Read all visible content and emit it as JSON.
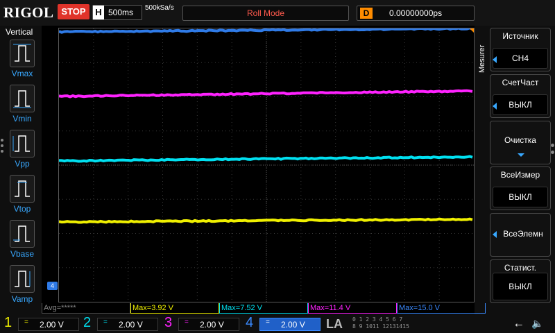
{
  "topbar": {
    "logo": "RIGOL",
    "run_state": "STOP",
    "timebase_icon": "H",
    "timebase": "500ms",
    "sample_rate": "500kSa/s",
    "mode": "Roll Mode",
    "delay_icon": "D",
    "delay": "0.00000000ps"
  },
  "left_menu": {
    "title": "Vertical",
    "items": [
      {
        "label": "Vmax",
        "icon": "vmax-icon"
      },
      {
        "label": "Vmin",
        "icon": "vmin-icon"
      },
      {
        "label": "Vpp",
        "icon": "vpp-icon"
      },
      {
        "label": "Vtop",
        "icon": "vtop-icon"
      },
      {
        "label": "Vbase",
        "icon": "vbase-icon"
      },
      {
        "label": "Vamp",
        "icon": "vamp-icon"
      }
    ]
  },
  "right_menu": {
    "side_label": "Mesurer",
    "buttons": [
      {
        "title": "Источник",
        "value": "CH4"
      },
      {
        "title": "СчетЧаст",
        "value": "ВЫКЛ"
      },
      {
        "title": "Очистка",
        "value": ""
      },
      {
        "title": "ВсеИзмер",
        "value": "ВЫКЛ"
      },
      {
        "title": "",
        "value": "ВсеЭлемн"
      },
      {
        "title": "Статист.",
        "value": "ВЫКЛ"
      }
    ]
  },
  "measurements": {
    "avg": "Avg=*****",
    "ch1_max": "Max=3.92 V",
    "ch2_max": "Max=7.52 V",
    "ch3_max": "Max=11.4 V",
    "ch4_max": "Max=15.0 V"
  },
  "channels": [
    {
      "num": "1",
      "coupling": "=",
      "scale": "2.00 V",
      "color": "#f0f000"
    },
    {
      "num": "2",
      "coupling": "=",
      "scale": "2.00 V",
      "color": "#00e0f0"
    },
    {
      "num": "3",
      "coupling": "=",
      "scale": "2.00 V",
      "color": "#ff22ff"
    },
    {
      "num": "4",
      "coupling": "=",
      "scale": "2.00 V",
      "color": "#3a8aff"
    }
  ],
  "bottom": {
    "la_label": "LA",
    "la_digits_row1": "0 1 2 3  4 5 6 7",
    "la_digits_row2": "8 9 1011 12131415"
  },
  "ch4_marker": "4",
  "colors": {
    "ch1": "#f0f000",
    "ch2": "#00e0f0",
    "ch3": "#ff22ff",
    "ch4": "#2f7be8",
    "stop": "#e0332a",
    "delay": "#ff8c00"
  }
}
